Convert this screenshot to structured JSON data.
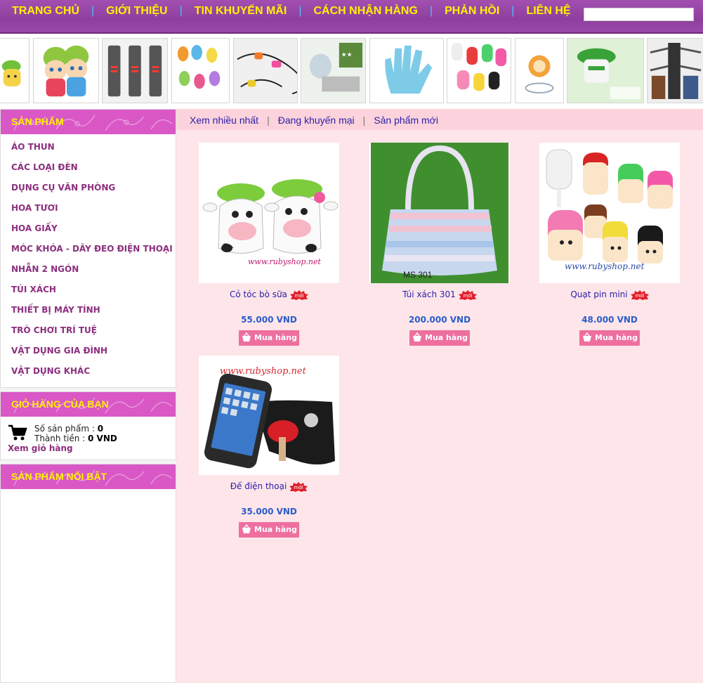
{
  "nav": {
    "items": [
      "TRANG CHỦ",
      "GIỚI THIỆU",
      "TIN KHUYẾN MÃI",
      "CÁCH NHẬN HÀNG",
      "PHẢN HỒI",
      "LIÊN HỆ"
    ],
    "separator": "|",
    "search_value": ""
  },
  "banner": {
    "items": [
      "plant-pot",
      "dolls",
      "led-watches",
      "keychains",
      "cables",
      "slicer",
      "glove-brush",
      "popsicle-fans",
      "fruit-tool",
      "mosquito-lamp",
      "hanger"
    ]
  },
  "sidebar": {
    "categories_title": "SẢN PHẨM",
    "categories": [
      "ÁO THUN",
      "CÁC LOẠI ĐÈN",
      "DỤNG CỤ VĂN PHÒNG",
      "HOA TƯƠI",
      "HOA GIẤY",
      "MÓC KHÓA - DÂY ĐEO ĐIỆN THOẠI",
      "NHẪN 2 NGÓN",
      "TÚI XÁCH",
      "THIẾT BỊ MÁY TÍNH",
      "TRÒ CHƠI TRÍ TUỆ",
      "VẬT DỤNG GIA ĐÌNH",
      "VẬT DỤNG KHÁC"
    ],
    "cart": {
      "title": "GIỎ HÀNG CỦA BẠN",
      "count_label": "Số sản phẩm :",
      "count_value": "0",
      "total_label": "Thành tiền :",
      "total_value": "0 VND",
      "view_link": "Xem giỏ hàng"
    },
    "featured_title": "SẢN PHẨM NỔI BẬT"
  },
  "tabs": {
    "items": [
      "Xem nhiều nhất",
      "Đang khuyến mại",
      "Sản phẩm mới"
    ],
    "separator": "|"
  },
  "products": [
    {
      "name": "Cỏ tóc bò sữa",
      "price": "55.000 VND",
      "badge": "mới",
      "image": "cow-grass-pots",
      "watermark": "www.rubyshop.net"
    },
    {
      "name": "Túi xách 301",
      "price": "200.000 VND",
      "badge": "mới",
      "image": "beaded-handbag",
      "caption": "MS 301"
    },
    {
      "name": "Quạt pin mini",
      "price": "48.000 VND",
      "badge": "mới",
      "image": "popsicle-fans",
      "watermark": "www.rubyshop.net"
    },
    {
      "name": "Đế điện thoại",
      "price": "35.000 VND",
      "badge": "mới",
      "image": "phone-stand",
      "watermark": "www.rubyshop.net"
    }
  ],
  "buy_label": "Mua hàng",
  "colors": {
    "nav_bg": "#9a4aa8",
    "nav_text": "#fff200",
    "box_head": "#d958c6",
    "main_bg": "#fde5ea",
    "tab_bg": "#fcd3dc",
    "link_blue": "#2a1ea8",
    "buy_button": "#ee6f9e"
  }
}
